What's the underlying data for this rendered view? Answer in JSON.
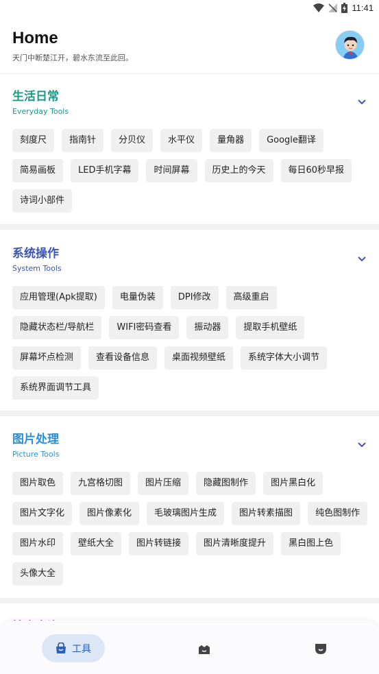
{
  "status_bar": {
    "time": "11:41"
  },
  "header": {
    "title": "Home",
    "subtitle": "天门中断楚江开，碧水东流至此回。"
  },
  "sections": [
    {
      "title": "生活日常",
      "subtitle": "Everyday Tools",
      "color": "#1a9a86",
      "items": [
        "刻度尺",
        "指南针",
        "分贝仪",
        "水平仪",
        "量角器",
        "Google翻译",
        "简易画板",
        "LED手机字幕",
        "时间屏幕",
        "历史上的今天",
        "每日60秒早报",
        "诗词小部件"
      ]
    },
    {
      "title": "系统操作",
      "subtitle": "System Tools",
      "color": "#3b55b7",
      "items": [
        "应用管理(Apk提取)",
        "电量伪装",
        "DPI修改",
        "高级重启",
        "隐藏状态栏/导航栏",
        "WIFI密码查看",
        "振动器",
        "提取手机壁纸",
        "屏幕坏点检测",
        "查看设备信息",
        "桌面视频壁纸",
        "系统字体大小调节",
        "系统界面调节工具"
      ]
    },
    {
      "title": "图片处理",
      "subtitle": "Picture Tools",
      "color": "#2b8fd8",
      "items": [
        "图片取色",
        "九宫格切图",
        "图片压缩",
        "隐藏图制作",
        "图片黑白化",
        "图片文字化",
        "图片像素化",
        "毛玻璃图片生成",
        "图片转素描图",
        "纯色图制作",
        "图片水印",
        "壁纸大全",
        "图片转链接",
        "图片清晰度提升",
        "黑白图上色",
        "头像大全"
      ]
    },
    {
      "title": "搜索查询",
      "color": "#9b36b8"
    }
  ],
  "bottom_nav": {
    "items": [
      {
        "label": "工具",
        "icon": "bag-icon",
        "active": true
      },
      {
        "icon": "home-icon",
        "active": false
      },
      {
        "icon": "face-icon",
        "active": false
      }
    ]
  }
}
